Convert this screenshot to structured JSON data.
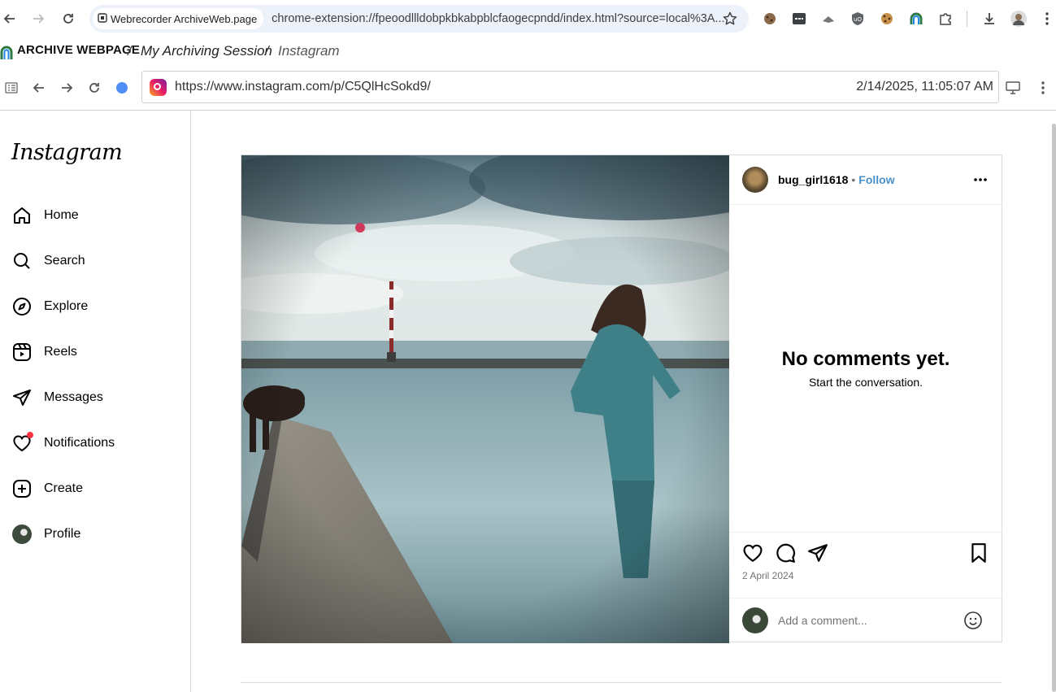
{
  "browser": {
    "extension_chip": "Webrecorder ArchiveWeb.page",
    "url": "chrome-extension://fpeoodllldobpkbkabpblcfaogecpndd/index.html?source=local%3A...",
    "icons": [
      "back-icon",
      "forward-icon",
      "reload-icon",
      "site-info-icon",
      "star-icon",
      "download-icon",
      "menu-icon"
    ]
  },
  "archive": {
    "app_title": "ARCHIVE WEBPAGE",
    "separator": "/",
    "session": "My Archiving Session",
    "page": "Instagram"
  },
  "replay": {
    "url": "https://www.instagram.com/p/C5QlHcSokd9/",
    "timestamp": "2/14/2025, 11:05:07 AM"
  },
  "instagram": {
    "logo": "Instagram",
    "nav": [
      {
        "label": "Home",
        "icon": "home-icon"
      },
      {
        "label": "Search",
        "icon": "search-icon"
      },
      {
        "label": "Explore",
        "icon": "compass-icon"
      },
      {
        "label": "Reels",
        "icon": "reels-icon"
      },
      {
        "label": "Messages",
        "icon": "send-icon"
      },
      {
        "label": "Notifications",
        "icon": "heart-icon"
      },
      {
        "label": "Create",
        "icon": "plus-square-icon"
      },
      {
        "label": "Profile",
        "icon": "avatar-icon"
      }
    ],
    "post": {
      "username": "bug_girl1618",
      "dot": "•",
      "follow": "Follow",
      "empty_title": "No comments yet.",
      "empty_sub": "Start the conversation.",
      "date": "2 April 2024",
      "comment_placeholder": "Add a comment..."
    }
  },
  "colors": {
    "follow": "#4a90c8",
    "notification_dot": "#ff3040",
    "omnibox_bg": "#edf2fa"
  }
}
